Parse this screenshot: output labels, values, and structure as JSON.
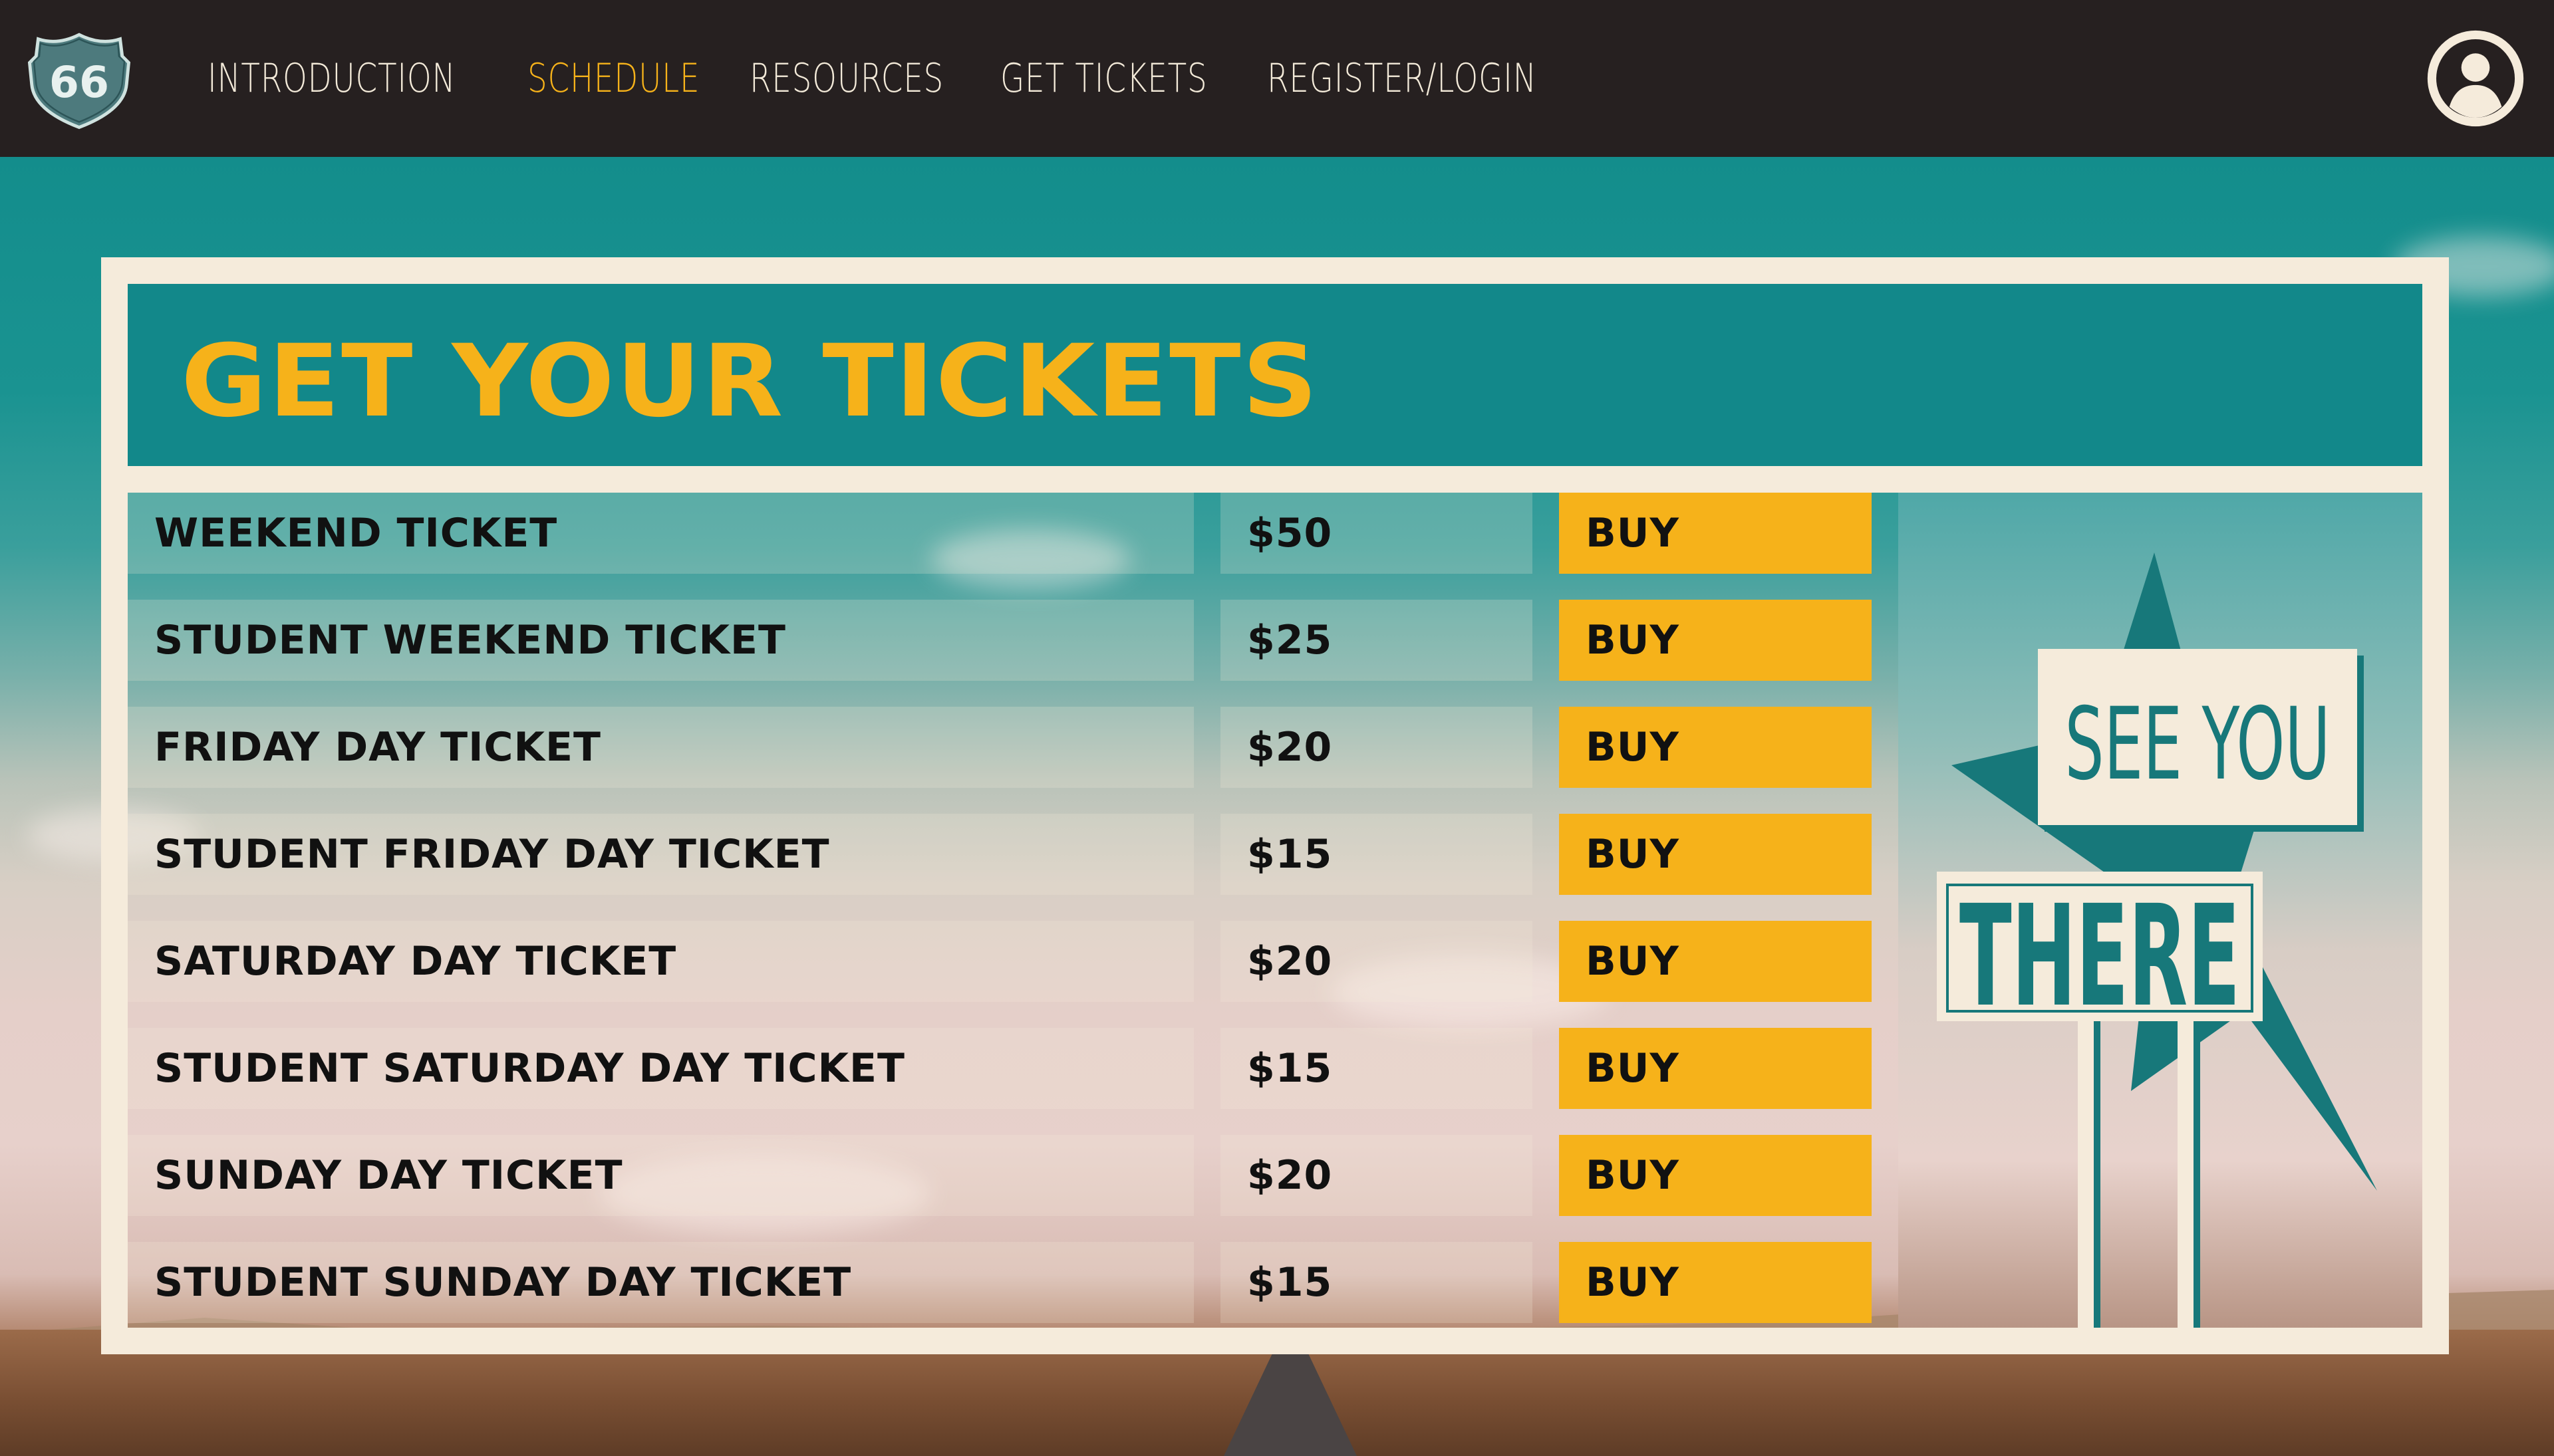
{
  "nav": {
    "logo_text": "66",
    "links": [
      {
        "label": "INTRODUCTION"
      },
      {
        "label": "SCHEDULE"
      },
      {
        "label": "RESOURCES"
      },
      {
        "label": "GET TICKETS"
      },
      {
        "label": "REGISTER/LOGIN"
      }
    ],
    "active_link": "SCHEDULE"
  },
  "tickets": {
    "title": "GET YOUR TICKETS",
    "rows": [
      {
        "name": "WEEKEND TICKET",
        "price": "$50",
        "action": "BUY"
      },
      {
        "name": "STUDENT WEEKEND TICKET",
        "price": "$25",
        "action": "BUY"
      },
      {
        "name": "FRIDAY DAY TICKET",
        "price": "$20",
        "action": "BUY"
      },
      {
        "name": "STUDENT FRIDAY DAY TICKET",
        "price": "$15",
        "action": "BUY"
      },
      {
        "name": "SATURDAY DAY TICKET",
        "price": "$20",
        "action": "BUY"
      },
      {
        "name": "STUDENT SATURDAY DAY TICKET",
        "price": "$15",
        "action": "BUY"
      },
      {
        "name": "SUNDAY DAY TICKET",
        "price": "$20",
        "action": "BUY"
      },
      {
        "name": "STUDENT SUNDAY DAY TICKET",
        "price": "$15",
        "action": "BUY"
      }
    ]
  },
  "sign": {
    "line1": "SEE YOU",
    "line2": "THERE"
  },
  "colors": {
    "accent": "#f6b21a",
    "teal": "#12888a",
    "cream": "#f5ebdb",
    "navbar": "#262020"
  },
  "icons": {
    "logo": "route-66-shield-icon",
    "avatar": "user-profile-icon"
  }
}
